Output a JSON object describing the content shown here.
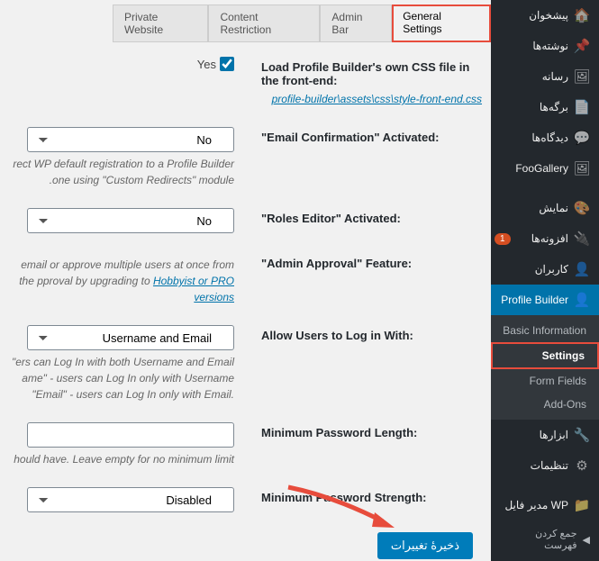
{
  "sidebar": {
    "items": [
      {
        "label": "پیشخوان",
        "icon": "🏠"
      },
      {
        "label": "نوشته‌ها",
        "icon": "📌"
      },
      {
        "label": "رسانه",
        "icon": "🖼"
      },
      {
        "label": "برگه‌ها",
        "icon": "📄"
      },
      {
        "label": "دیدگاه‌ها",
        "icon": "💬"
      },
      {
        "label": "FooGallery",
        "icon": "🖼"
      },
      {
        "label": "نمایش",
        "icon": "🎨"
      },
      {
        "label": "افزونه‌ها",
        "icon": "🔌",
        "badge": "1"
      },
      {
        "label": "کاربران",
        "icon": "👤"
      },
      {
        "label": "Profile Builder",
        "icon": "👤",
        "active": true
      },
      {
        "label": "ابزارها",
        "icon": "🔧"
      },
      {
        "label": "تنظیمات",
        "icon": "⚙"
      },
      {
        "label": "WP مدیر فایل",
        "icon": "📁"
      }
    ],
    "submenu": [
      {
        "label": "Basic Information"
      },
      {
        "label": "Settings",
        "current": true
      },
      {
        "label": "Form Fields"
      },
      {
        "label": "Add-Ons"
      }
    ],
    "collapse": "جمع کردن فهرست"
  },
  "tabs": [
    {
      "label": "Private Website"
    },
    {
      "label": "Content Restriction"
    },
    {
      "label": "Admin Bar"
    },
    {
      "label": "General Settings",
      "active": true
    }
  ],
  "form": {
    "css_label": "Load Profile Builder's own CSS file in the front-end:",
    "css_yes": "Yes",
    "css_path": "profile-builder\\assets\\css\\style-front-end.css",
    "email_conf_label": "\"Email Confirmation\" Activated:",
    "email_conf_value": "No",
    "email_conf_help": "rect WP default registration to a Profile Builder .one using \"Custom Redirects\" module",
    "roles_label": "\"Roles Editor\" Activated:",
    "roles_value": "No",
    "approval_label": "\"Admin Approval\" Feature:",
    "approval_help_1": "email or approve multiple users at once from the pproval by upgrading to ",
    "approval_help_link": "Hobbyist or PRO versions",
    "login_label": "Allow Users to Log in With:",
    "login_value": "Username and Email",
    "login_help": "\"ers can Log In with both Username and Email ame\" - users can Log In only with Username \"Email\" - users can Log In only with Email.",
    "minlen_label": "Minimum Password Length:",
    "minlen_help": "hould have. Leave empty for no minimum limit",
    "strength_label": "Minimum Password Strength:",
    "strength_value": "Disabled",
    "save": "ذخیرهٔ تغییرات"
  }
}
